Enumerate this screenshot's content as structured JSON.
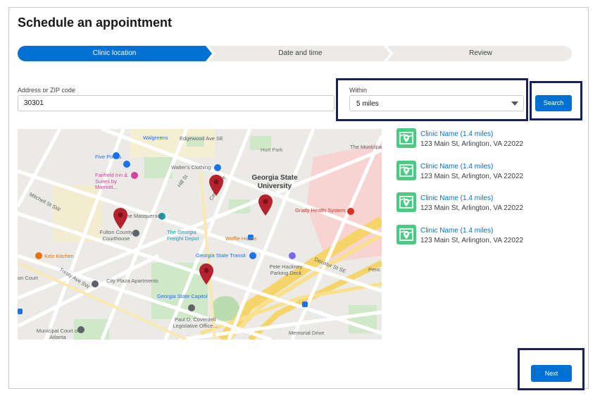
{
  "page": {
    "title": "Schedule an appointment"
  },
  "path": {
    "steps": [
      {
        "label": "Clinic location",
        "state": "current"
      },
      {
        "label": "Date and time",
        "state": "incomplete"
      },
      {
        "label": "Review",
        "state": "incomplete"
      }
    ]
  },
  "form": {
    "address_label": "Address or ZIP code",
    "address_value": "30301",
    "within_label": "Within",
    "within_value": "5 miles",
    "search_label": "Search"
  },
  "map": {
    "labels": {
      "edgewood": "Edgewood Ave SE",
      "walgreens": "Walgreens",
      "hurt_park": "Hurt Park",
      "municipal_top": "The Municipal",
      "five_points": "Five Points",
      "fairfield": "Fairfield Inn & Suites by Marriott...",
      "walters": "Walter's Clothing",
      "gsu": "Georgia State University",
      "mitchell": "Mitchell St SW",
      "masquerade": "The Masquerade",
      "grady": "Grady Health System",
      "fulton": "Fulton County Courthouse",
      "freight_depot": "The Georgia Freight Depot",
      "waffle_house": "Waffle House",
      "gsu_transit": "Georgia State Transit",
      "kelz": "Kelz Kitchen",
      "pete_hackney": "Pete Hackney Parking Deck",
      "decatur": "Decatur St SE",
      "penc": "Penc",
      "trinity": "Trinity Ave SW",
      "on_court": "on Court",
      "city_plaza": "City Plaza Apartments",
      "capitol": "Georgia State Capitol",
      "coverdell": "Paul D. Coverdell Legislative Office...",
      "municipal_court": "Municipal Court of Atlanta",
      "memorial": "Memorial Drive",
      "central_ave": "Central Ave",
      "hill_st": "Hill St"
    },
    "pin_color": "#b3222d"
  },
  "results": [
    {
      "name": "Clinic Name (1.4 miles)",
      "address": "123 Main St, Arlington, VA 22022"
    },
    {
      "name": "Clinic Name (1.4 miles)",
      "address": "123 Main St, Arlington, VA 22022"
    },
    {
      "name": "Clinic Name (1.4 miles)",
      "address": "123 Main St, Arlington, VA 22022"
    },
    {
      "name": "Clinic Name (1.4 miles)",
      "address": "123 Main St, Arlington, VA 22022"
    }
  ],
  "footer": {
    "next_label": "Next"
  },
  "colors": {
    "brand": "#0070d2",
    "highlight_border": "#1b1f5c",
    "result_icon": "#4bca81",
    "path_inactive": "#ecebea"
  }
}
